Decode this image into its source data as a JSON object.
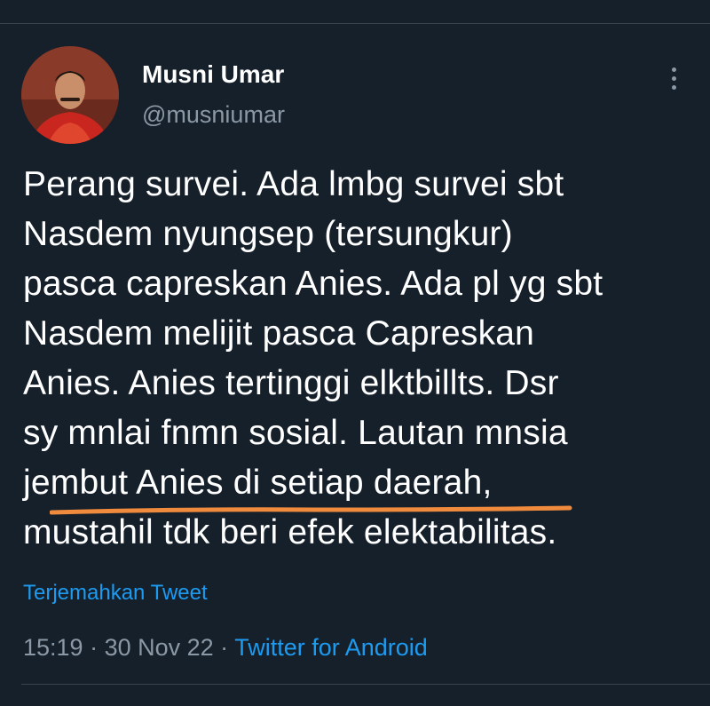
{
  "tweet": {
    "author": {
      "display_name": "Musni Umar",
      "handle": "@musniumar"
    },
    "text_lines": [
      "Perang survei. Ada lmbg survei sbt",
      "Nasdem nyungsep (tersungkur)",
      "pasca capreskan Anies. Ada pl yg sbt",
      "Nasdem melijit pasca Capreskan",
      "Anies. Anies tertinggi elktbillts. Dsr",
      "sy mnlai fnmn sosial. Lautan mnsia",
      "jembut Anies di setiap  daerah,",
      "mustahil tdk beri efek elektabilitas."
    ],
    "translate_label": "Terjemahkan Tweet",
    "meta": {
      "time": "15:19",
      "separator": " · ",
      "date": "30 Nov 22",
      "source": "Twitter for Android"
    }
  },
  "icons": {
    "more": "more-vertical-icon"
  },
  "colors": {
    "background": "#15202b",
    "text": "#ffffff",
    "muted": "#8b98a5",
    "link": "#1d9bf0",
    "divider": "#38444d",
    "highlight_underline": "#f08a3c"
  }
}
